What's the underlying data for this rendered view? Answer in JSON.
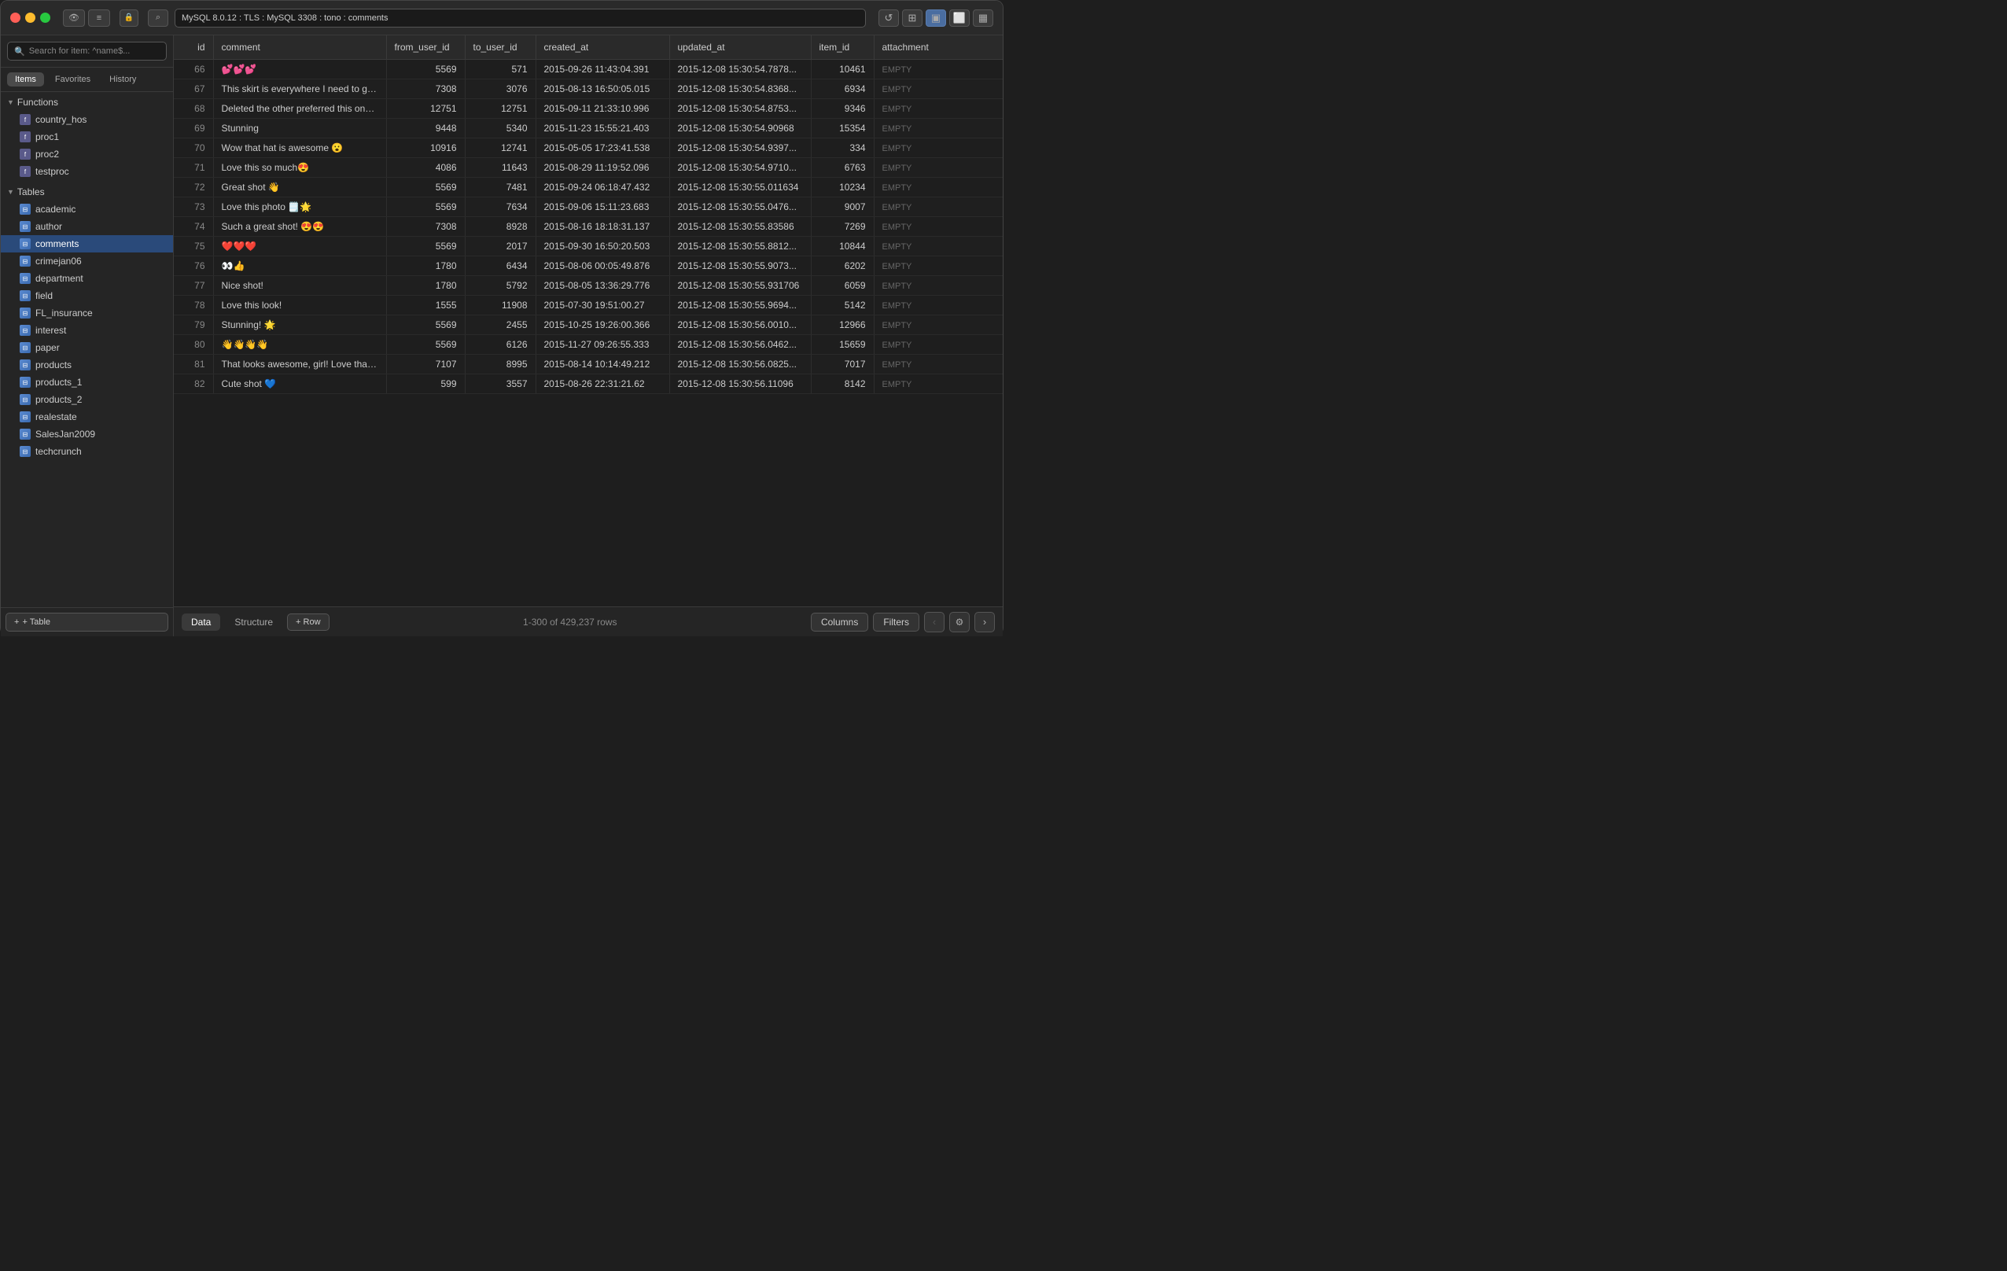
{
  "titlebar": {
    "connection": "MySQL 8.0.12 : TLS : MySQL 3308 : tono : comments",
    "icons": {
      "eye": "👁",
      "menu": "≡",
      "lock": "🔒",
      "search": "⌕",
      "refresh": "↺",
      "grid": "⊞",
      "split1": "▣",
      "split2": "⬜",
      "split3": "▦"
    }
  },
  "sidebar": {
    "search_placeholder": "Search for item: ^name$...",
    "tabs": [
      "Items",
      "Favorites",
      "History"
    ],
    "active_tab": "Items",
    "sections": {
      "functions": {
        "label": "Functions",
        "items": [
          "country_hos",
          "proc1",
          "proc2",
          "testproc"
        ]
      },
      "tables": {
        "label": "Tables",
        "items": [
          "academic",
          "author",
          "comments",
          "crimejan06",
          "department",
          "field",
          "FL_insurance",
          "interest",
          "paper",
          "products",
          "products_1",
          "products_2",
          "realestate",
          "SalesJan2009",
          "techcrunch"
        ]
      }
    },
    "active_item": "comments"
  },
  "columns": [
    "id",
    "comment",
    "from_user_id",
    "to_user_id",
    "created_at",
    "updated_at",
    "item_id",
    "attachment"
  ],
  "rows": [
    {
      "id": "66",
      "comment": "💕💕💕",
      "from_user_id": "5569",
      "to_user_id": "571",
      "created_at": "2015-09-26 11:43:04.391",
      "updated_at": "2015-12-08 15:30:54.7878...",
      "item_id": "10461",
      "attachment": "EMPTY"
    },
    {
      "id": "67",
      "comment": "This skirt is everywhere I need to get my hands on it!...",
      "from_user_id": "7308",
      "to_user_id": "3076",
      "created_at": "2015-08-13 16:50:05.015",
      "updated_at": "2015-12-08 15:30:54.8368...",
      "item_id": "6934",
      "attachment": "EMPTY"
    },
    {
      "id": "68",
      "comment": "Deleted the other preferred this one haha😀",
      "from_user_id": "12751",
      "to_user_id": "12751",
      "created_at": "2015-09-11 21:33:10.996",
      "updated_at": "2015-12-08 15:30:54.8753...",
      "item_id": "9346",
      "attachment": "EMPTY"
    },
    {
      "id": "69",
      "comment": "Stunning",
      "from_user_id": "9448",
      "to_user_id": "5340",
      "created_at": "2015-11-23 15:55:21.403",
      "updated_at": "2015-12-08 15:30:54.90968",
      "item_id": "15354",
      "attachment": "EMPTY"
    },
    {
      "id": "70",
      "comment": "Wow that hat is awesome 😮",
      "from_user_id": "10916",
      "to_user_id": "12741",
      "created_at": "2015-05-05 17:23:41.538",
      "updated_at": "2015-12-08 15:30:54.9397...",
      "item_id": "334",
      "attachment": "EMPTY"
    },
    {
      "id": "71",
      "comment": "Love this so much😍",
      "from_user_id": "4086",
      "to_user_id": "11643",
      "created_at": "2015-08-29 11:19:52.096",
      "updated_at": "2015-12-08 15:30:54.9710...",
      "item_id": "6763",
      "attachment": "EMPTY"
    },
    {
      "id": "72",
      "comment": "Great shot 👋",
      "from_user_id": "5569",
      "to_user_id": "7481",
      "created_at": "2015-09-24 06:18:47.432",
      "updated_at": "2015-12-08 15:30:55.011634",
      "item_id": "10234",
      "attachment": "EMPTY"
    },
    {
      "id": "73",
      "comment": "Love this photo 🗒️🌟",
      "from_user_id": "5569",
      "to_user_id": "7634",
      "created_at": "2015-09-06 15:11:23.683",
      "updated_at": "2015-12-08 15:30:55.0476...",
      "item_id": "9007",
      "attachment": "EMPTY"
    },
    {
      "id": "74",
      "comment": "Such a great shot! 😍😍",
      "from_user_id": "7308",
      "to_user_id": "8928",
      "created_at": "2015-08-16 18:18:31.137",
      "updated_at": "2015-12-08 15:30:55.83586",
      "item_id": "7269",
      "attachment": "EMPTY"
    },
    {
      "id": "75",
      "comment": "❤️❤️❤️",
      "from_user_id": "5569",
      "to_user_id": "2017",
      "created_at": "2015-09-30 16:50:20.503",
      "updated_at": "2015-12-08 15:30:55.8812...",
      "item_id": "10844",
      "attachment": "EMPTY"
    },
    {
      "id": "76",
      "comment": "👀👍",
      "from_user_id": "1780",
      "to_user_id": "6434",
      "created_at": "2015-08-06 00:05:49.876",
      "updated_at": "2015-12-08 15:30:55.9073...",
      "item_id": "6202",
      "attachment": "EMPTY"
    },
    {
      "id": "77",
      "comment": "Nice shot!",
      "from_user_id": "1780",
      "to_user_id": "5792",
      "created_at": "2015-08-05 13:36:29.776",
      "updated_at": "2015-12-08 15:30:55.931706",
      "item_id": "6059",
      "attachment": "EMPTY"
    },
    {
      "id": "78",
      "comment": "Love this look!",
      "from_user_id": "1555",
      "to_user_id": "11908",
      "created_at": "2015-07-30 19:51:00.27",
      "updated_at": "2015-12-08 15:30:55.9694...",
      "item_id": "5142",
      "attachment": "EMPTY"
    },
    {
      "id": "79",
      "comment": "Stunning! 🌟",
      "from_user_id": "5569",
      "to_user_id": "2455",
      "created_at": "2015-10-25 19:26:00.366",
      "updated_at": "2015-12-08 15:30:56.0010...",
      "item_id": "12966",
      "attachment": "EMPTY"
    },
    {
      "id": "80",
      "comment": "👋👋👋👋",
      "from_user_id": "5569",
      "to_user_id": "6126",
      "created_at": "2015-11-27 09:26:55.333",
      "updated_at": "2015-12-08 15:30:56.0462...",
      "item_id": "15659",
      "attachment": "EMPTY"
    },
    {
      "id": "81",
      "comment": "That looks awesome, girl! Love that outfit! It's your o...",
      "from_user_id": "7107",
      "to_user_id": "8995",
      "created_at": "2015-08-14 10:14:49.212",
      "updated_at": "2015-12-08 15:30:56.0825...",
      "item_id": "7017",
      "attachment": "EMPTY"
    },
    {
      "id": "82",
      "comment": "Cute shot 💙",
      "from_user_id": "599",
      "to_user_id": "3557",
      "created_at": "2015-08-26 22:31:21.62",
      "updated_at": "2015-12-08 15:30:56.11096",
      "item_id": "8142",
      "attachment": "EMPTY"
    }
  ],
  "bottom": {
    "tabs": [
      "Data",
      "Structure"
    ],
    "active_tab": "Data",
    "row_count": "1-300 of 429,237 rows",
    "add_row_label": "+ Row",
    "columns_btn": "Columns",
    "filters_btn": "Filters"
  },
  "add_table_label": "+ Table"
}
